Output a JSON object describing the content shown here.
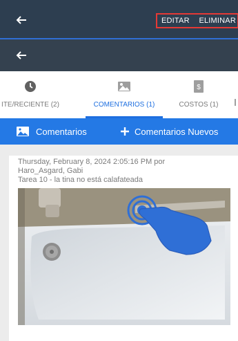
{
  "topbar": {
    "back_icon": "arrow-left-icon",
    "actions": {
      "edit": "EDITAR",
      "delete": "ELIMINAR"
    }
  },
  "subbar": {
    "back_icon": "arrow-left-icon"
  },
  "tabs": [
    {
      "label": "ITE/RECIENTE (2)",
      "icon": "clock-icon"
    },
    {
      "label": "COMENTARIOS (1)",
      "icon": "photo-icon"
    },
    {
      "label": "COSTOS (1)",
      "icon": "invoice-icon"
    }
  ],
  "actions_bar": {
    "comments_label": "Comentarios",
    "new_comment_label": "Comentarios Nuevos"
  },
  "comment": {
    "timestamp": "Thursday, February 8, 2024 2:05:16 PM por",
    "author": "Haro_Asgard, Gabi",
    "text": "Tarea 10 - la tina no está calafateada"
  },
  "colors": {
    "topbar": "#2d3e50",
    "accent": "#1e6fe0",
    "action_bar": "#2479e5",
    "highlight_box": "#e53935"
  }
}
